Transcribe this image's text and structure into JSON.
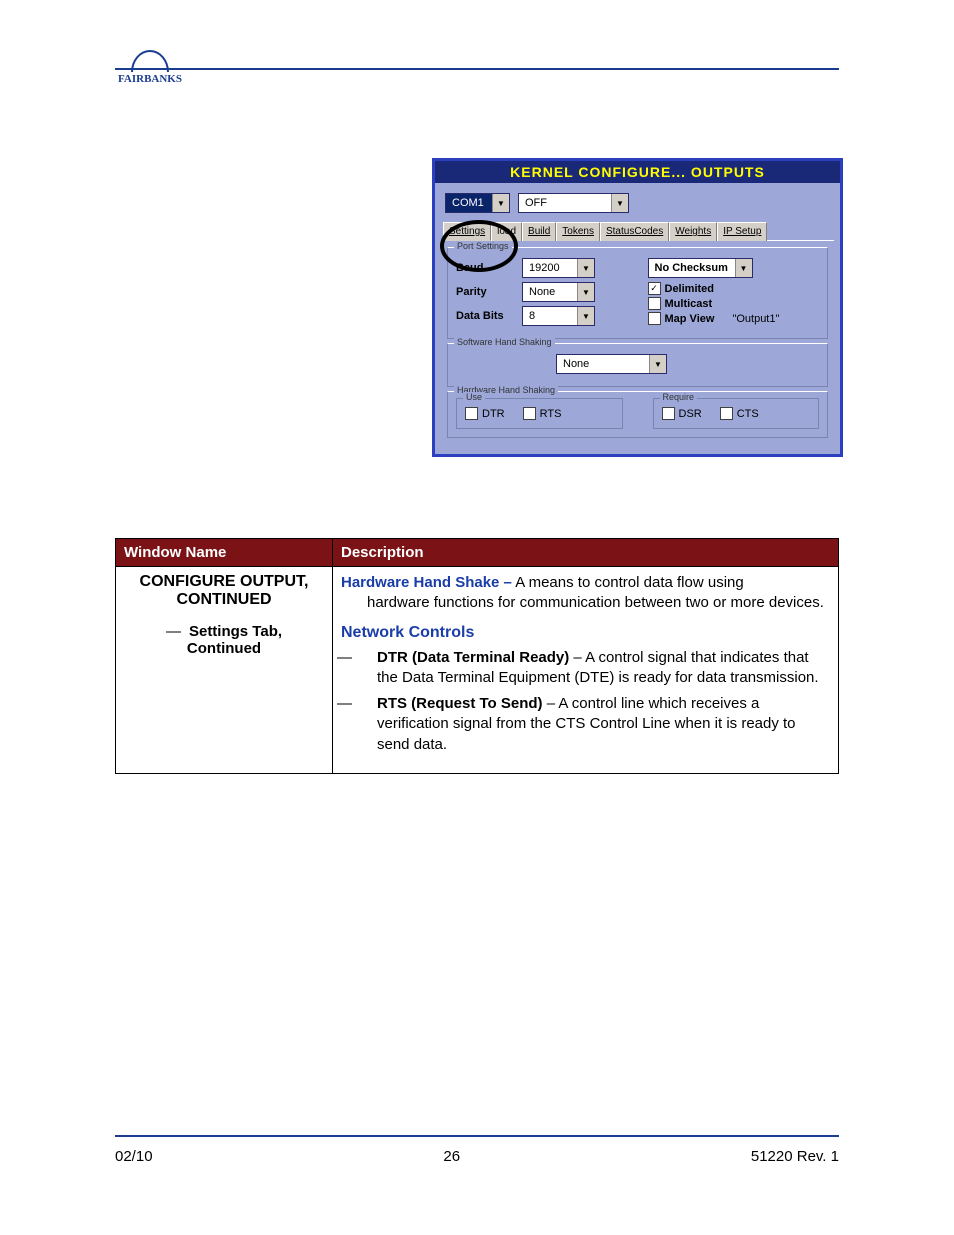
{
  "logo_text": "FAIRBANKS",
  "footer": {
    "left": "02/10",
    "center": "26",
    "right": "51220   Rev. 1"
  },
  "screenshot": {
    "title": "KERNEL CONFIGURE... OUTPUTS",
    "com_select": "COM1",
    "off_select": "OFF",
    "tabs": [
      "Settings",
      "load",
      "Build",
      "Tokens",
      "StatusCodes",
      "Weights",
      "IP Setup"
    ],
    "port_settings": {
      "legend": "Port Settings",
      "baud_label": "Baud",
      "baud_value": "19200",
      "parity_label": "Parity",
      "parity_value": "None",
      "databits_label": "Data Bits",
      "databits_value": "8",
      "checksum_value": "No Checksum",
      "delimited_label": "Delimited",
      "multicast_label": "Multicast",
      "mapview_label": "Map View",
      "mapview_value": "\"Output1\""
    },
    "sw_hs": {
      "legend": "Software Hand Shaking",
      "value": "None"
    },
    "hw_hs": {
      "legend": "Hardware Hand Shaking",
      "use_legend": "Use",
      "dtr": "DTR",
      "rts": "RTS",
      "require_legend": "Require",
      "dsr": "DSR",
      "cts": "CTS"
    }
  },
  "table": {
    "headers": {
      "window_name": "Window Name",
      "description": "Description"
    },
    "window_name": {
      "line1": "CONFIGURE OUTPUT,",
      "line2": "CONTINUED",
      "sub1": "Settings Tab,",
      "sub2": "Continued"
    },
    "description": {
      "hhs_label": "Hardware Hand Shake –",
      "hhs_text1": " A means to control data flow using",
      "hhs_text2": "hardware functions for communication between two or more devices.",
      "nc_label": "Network Controls",
      "dtr_bold": "DTR (Data Terminal Ready)",
      "dtr_rest": " – A control signal that indicates that the Data Terminal Equipment (DTE) is ready for data transmission.",
      "rts_bold": "RTS (Request To Send)",
      "rts_rest": " – A control line which receives a verification signal from the CTS Control Line when it is ready to send data."
    }
  }
}
